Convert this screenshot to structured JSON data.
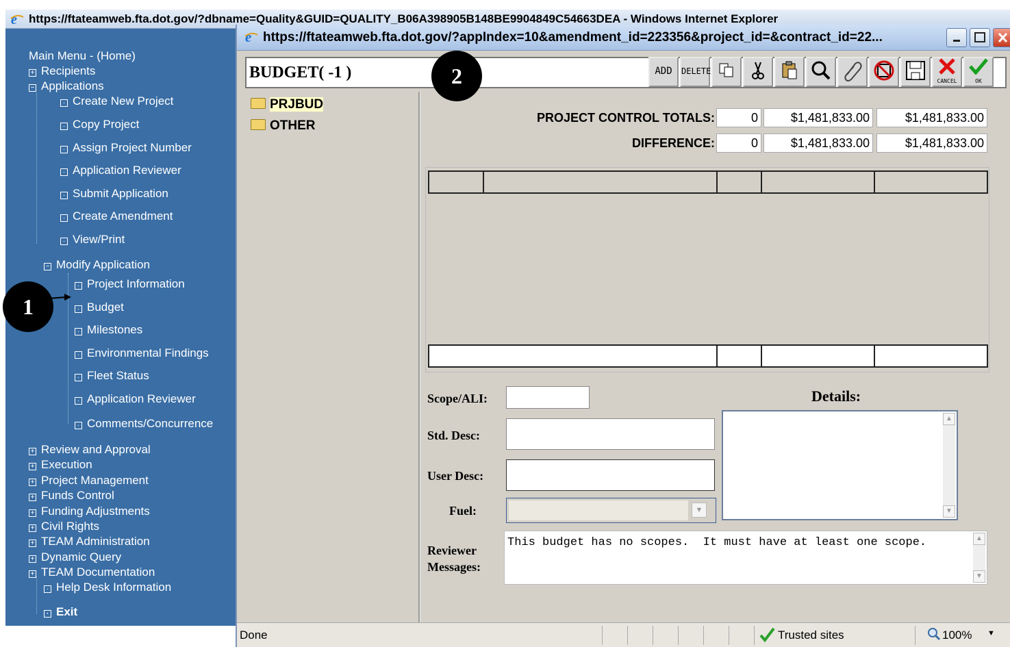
{
  "back_window": {
    "title": "https://ftateamweb.fta.dot.gov/?dbname=Quality&GUID=QUALITY_B06A398905B148BE9904849C54663DEA - Windows Internet Explorer"
  },
  "nav": {
    "main_menu": "Main Menu - (Home)",
    "recipients": "Recipients",
    "applications": "Applications",
    "app_items": [
      "Create New Project",
      "Copy Project",
      "Assign Project Number",
      "Application Reviewer",
      "Submit Application",
      "Create Amendment",
      "View/Print"
    ],
    "modify_application": "Modify Application",
    "modify_items": [
      "Project Information",
      "Budget",
      "Milestones",
      "Environmental Findings",
      "Fleet Status",
      "Application Reviewer",
      "Comments/Concurrence"
    ],
    "bottom_items": [
      "Review and Approval",
      "Execution",
      "Project Management",
      "Funds Control",
      "Funding Adjustments",
      "Civil Rights",
      "TEAM Administration",
      "Dynamic Query",
      "TEAM Documentation"
    ],
    "help_desk": "Help Desk Information",
    "exit": "Exit"
  },
  "callouts": [
    "1",
    "2"
  ],
  "popup": {
    "title": "https://ftateamweb.fta.dot.gov/?appIndex=10&amendment_id=223356&project_id=&contract_id=22...",
    "budget_title": "BUDGET( -1 )",
    "toolbar": {
      "add": "ADD",
      "delete": "DELETE",
      "cancel": "CANCEL",
      "ok": "OK"
    },
    "tree": [
      "PRJBUD",
      "OTHER"
    ],
    "totals": {
      "control_label": "PROJECT CONTROL TOTALS:",
      "difference_label": "DIFFERENCE:",
      "control_values": [
        "0",
        "$1,481,833.00",
        "$1,481,833.00"
      ],
      "difference_values": [
        "0",
        "$1,481,833.00",
        "$1,481,833.00"
      ]
    },
    "form": {
      "scope_label": "Scope/ALI:",
      "std_desc_label": "Std. Desc:",
      "user_desc_label": "User Desc:",
      "fuel_label": "Fuel:",
      "details_label": "Details:",
      "reviewer_label": "Reviewer Messages:",
      "reviewer_message": "This budget has no scopes.  It must have at least one scope."
    },
    "status": {
      "text": "Done",
      "zone": "Trusted sites",
      "zoom": "100%"
    }
  }
}
